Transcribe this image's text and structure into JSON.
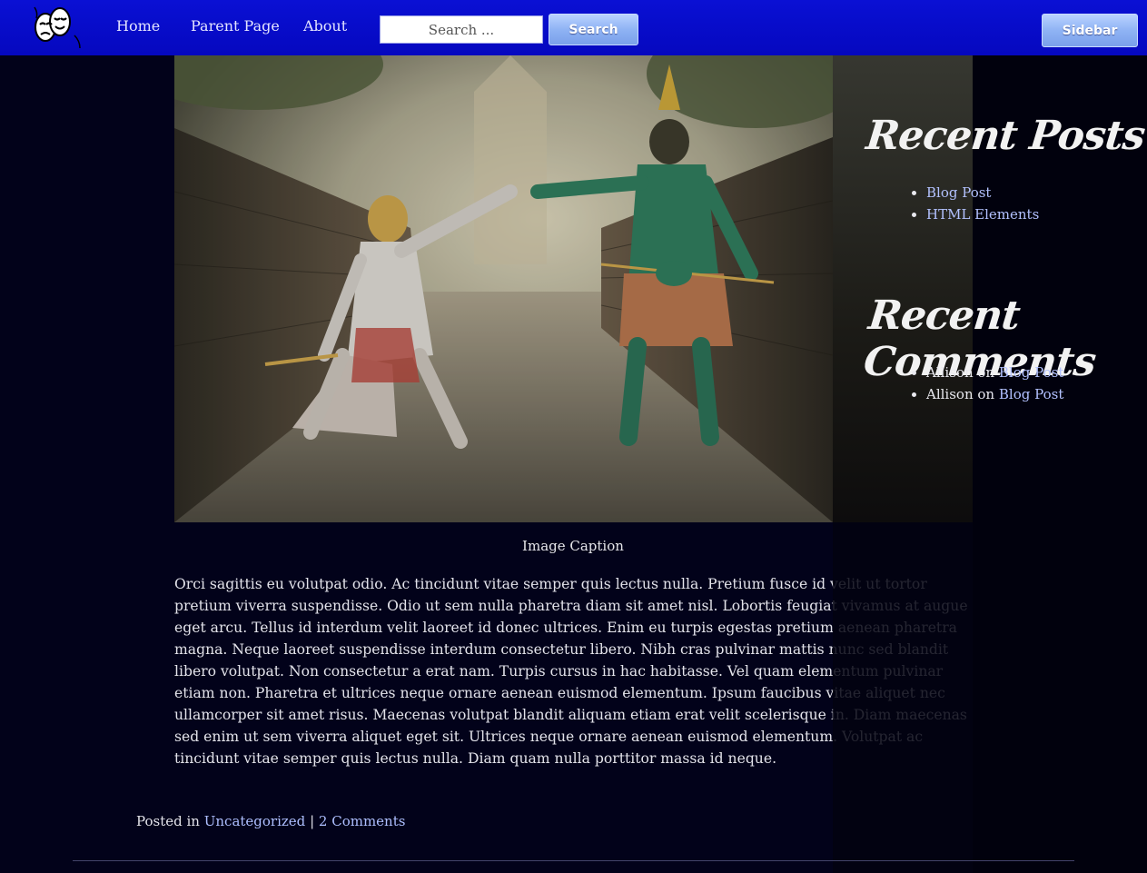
{
  "nav": {
    "items": [
      "Home",
      "Parent Page",
      "About"
    ],
    "search_placeholder": "Search ...",
    "search_button": "Search",
    "sidebar_button": "Sidebar"
  },
  "hero": {
    "icon": "theater-masks-icon"
  },
  "sidebar": {
    "recent_posts": {
      "title": "Recent Posts",
      "items": [
        "Blog Post",
        "HTML Elements"
      ]
    },
    "recent_comments": {
      "title": "Recent Comments",
      "items": [
        {
          "author": "Allison",
          "on": "on",
          "post": "Blog Post"
        },
        {
          "author": "Allison",
          "on": "on",
          "post": "Blog Post"
        }
      ]
    }
  },
  "article": {
    "caption": "Image Caption",
    "body": "Orci sagittis eu volutpat odio. Ac tincidunt vitae semper quis lectus nulla. Pretium fusce id velit ut tortor pretium viverra suspendisse. Odio ut sem nulla pharetra diam sit amet nisl. Lobortis feugiat vivamus at augue eget arcu. Tellus id interdum velit laoreet id donec ultrices. Enim eu turpis egestas pretium aenean pharetra magna. Neque laoreet suspendisse interdum consectetur libero. Nibh cras pulvinar mattis nunc sed blandit libero volutpat. Non consectetur a erat nam. Turpis cursus in hac habitasse. Vel quam elementum pulvinar etiam non. Pharetra et ultrices neque ornare aenean euismod elementum. Ipsum faucibus vitae aliquet nec ullamcorper sit amet risus. Maecenas volutpat blandit aliquam etiam erat velit scelerisque in. Diam maecenas sed enim ut sem viverra aliquet eget sit. Ultrices neque ornare aenean euismod elementum. Volutpat ac tincidunt vitae semper quis lectus nulla. Diam quam nulla porttitor massa id neque.",
    "meta": {
      "posted_in": "Posted in",
      "category": "Uncategorized",
      "separator": "|",
      "comments": "2 Comments"
    }
  },
  "colors": {
    "nav_bg": "#0508bf",
    "page_bg": "#02021a",
    "link": "#aebfff",
    "button": "#8fb3f4"
  }
}
